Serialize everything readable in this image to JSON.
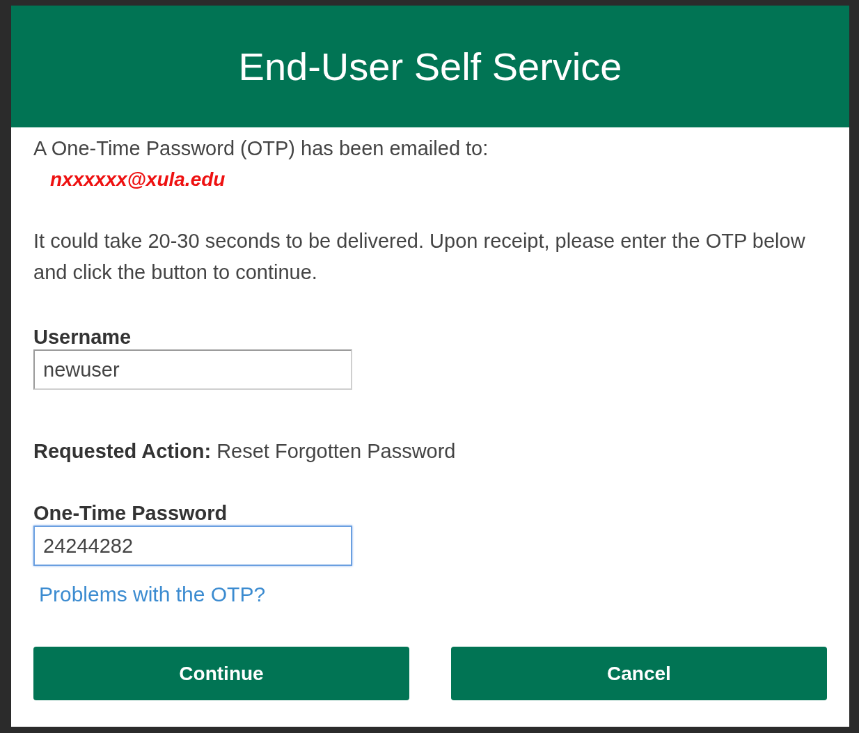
{
  "header": {
    "title": "End-User Self Service"
  },
  "notice": {
    "text": "A One-Time Password (OTP) has been emailed to:",
    "email": "nxxxxxx@xula.edu"
  },
  "instructions": "It could take 20-30 seconds to be delivered. Upon receipt, please enter the OTP below and click the button to continue.",
  "username": {
    "label": "Username",
    "value": "newuser",
    "focused": false
  },
  "requested_action": {
    "label": "Requested Action:",
    "value": "Reset Forgotten Password"
  },
  "otp": {
    "label": "One-Time Password",
    "value": "24244282",
    "focused": true
  },
  "help_link": "Problems with the OTP?",
  "buttons": [
    "Continue",
    "Cancel"
  ]
}
